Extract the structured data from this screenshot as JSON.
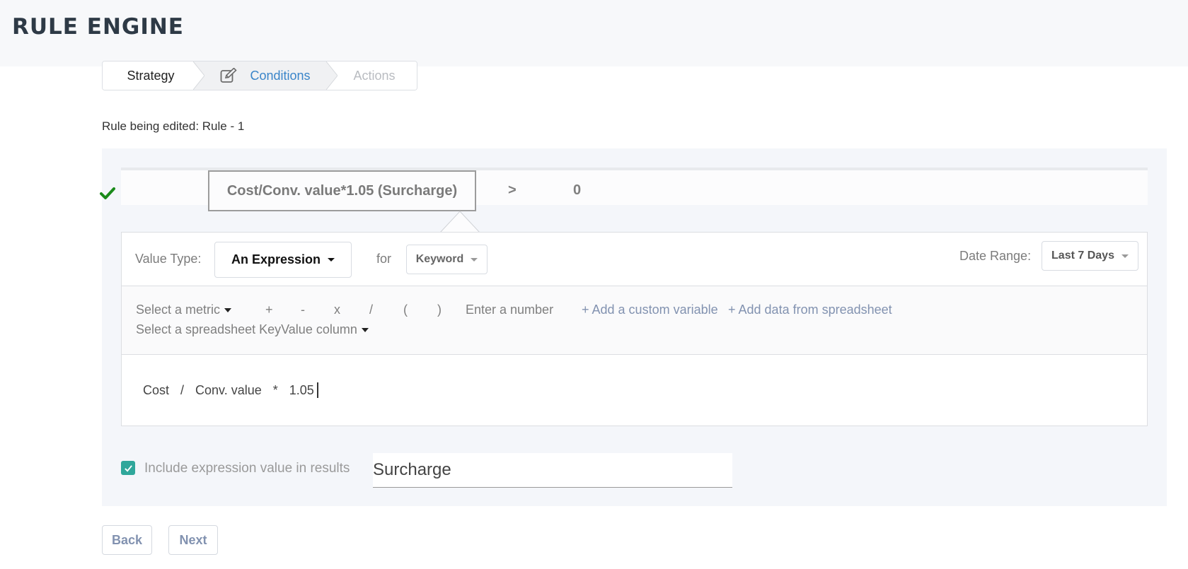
{
  "header": {
    "title": "RULE ENGINE"
  },
  "steps": [
    {
      "label": "Strategy",
      "state": "completed"
    },
    {
      "label": "Conditions",
      "state": "active",
      "icon": "edit-icon"
    },
    {
      "label": "Actions",
      "state": "disabled"
    }
  ],
  "rule_label": "Rule being edited: Rule - 1",
  "condition": {
    "status_icon": "check-icon",
    "expression_label": "Cost/Conv. value*1.05 (Surcharge)",
    "operator": ">",
    "value": "0"
  },
  "editor": {
    "value_type_label": "Value Type:",
    "value_type_selected": "An Expression",
    "for_label": "for",
    "for_selected": "Keyword",
    "date_range_label": "Date Range:",
    "date_range_selected": "Last 7 Days",
    "builder": {
      "select_metric": "Select a metric",
      "operators": [
        "+",
        "-",
        "x",
        "/",
        "(",
        ")"
      ],
      "enter_number": "Enter a number",
      "add_custom_variable": "+ Add a custom variable",
      "add_spreadsheet_data": "+ Add data from spreadsheet",
      "select_keyvalue_column": "Select a spreadsheet KeyValue column"
    },
    "expression_tokens": [
      "Cost",
      "/",
      "Conv. value",
      "*",
      "1.05"
    ]
  },
  "include": {
    "checked": true,
    "label": "Include expression value in results",
    "name_value": "Surcharge"
  },
  "buttons": {
    "back": "Back",
    "next": "Next"
  },
  "colors": {
    "active_step": "#3a85c9",
    "checkbox": "#2fa79b",
    "check_icon": "#1a8a1a",
    "link": "#8292b0"
  }
}
